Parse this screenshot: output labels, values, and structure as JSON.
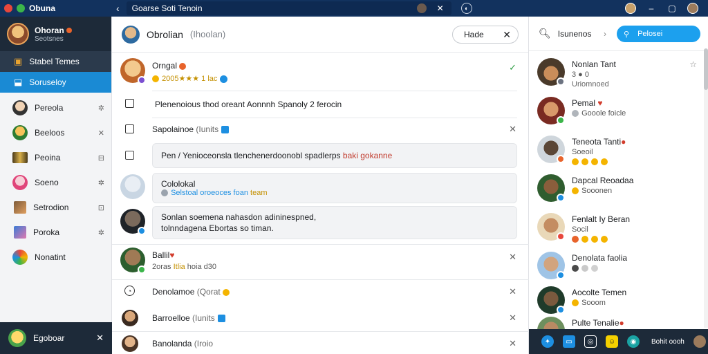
{
  "titlebar": {
    "app_title": "Obuna",
    "tab_title": "Goarse Soti Tenoin",
    "colors": {
      "bar": "#12325e",
      "red": "#e8473c",
      "green": "#3bb54a"
    }
  },
  "sidebar": {
    "profile": {
      "name": "Ohoran",
      "status": "Seotsnes"
    },
    "nav": [
      {
        "label": "Stabel Temes",
        "icon": "store-icon"
      },
      {
        "label": "Soruseloy",
        "icon": "inbox-icon"
      }
    ],
    "items": [
      {
        "label": "Pereola",
        "action": "✲"
      },
      {
        "label": "Beeloos",
        "action": "✕"
      },
      {
        "label": "Peoina",
        "action": "⊟"
      },
      {
        "label": "Soeno",
        "action": "✲"
      },
      {
        "label": "Setrodion",
        "action": "⊡"
      },
      {
        "label": "Poroka",
        "action": "✲"
      },
      {
        "label": "Nonatint",
        "action": ""
      }
    ],
    "footer": {
      "label": "Egoboar"
    }
  },
  "middle": {
    "header": {
      "name": "Obrolian",
      "sub": "(Ihoolan)",
      "button": "Hade"
    },
    "rows": [
      {
        "name": "Orngal",
        "sub": "2005★★★ 1 lac"
      },
      {
        "bubble": "Plenenoious thod oreant Aonnnh Spanoly 2 ferocin"
      },
      {
        "name": "Sapolainoe",
        "sub": "(Iunits"
      },
      {
        "bubble_main": "Pen / Yenioceonsla tlenchenerdoonobl spadlerps",
        "bubble_accent": "baki gokanne"
      },
      {
        "name": "Cololokal",
        "sub": "Selstoal oroeoces foan",
        "sub_accent": "team"
      },
      {
        "bubble_line1": "Sonlan soemena nahasdon adininespned,",
        "bubble_line2": "tolnndagena Ebortas so timan."
      },
      {
        "name": "Ballil",
        "sub_pre": "2oras",
        "sub_accent": "Itlia",
        "sub_post": "hoia d30"
      },
      {
        "name": "Denolamoe",
        "sub": "(Qorat"
      },
      {
        "name": "Barroelloe",
        "sub": "(Iunits"
      },
      {
        "name": "Banolanda",
        "sub": "(Iroio"
      }
    ],
    "colors": {
      "accent_text": "#c0392b",
      "blue": "#1d8fe1"
    }
  },
  "right": {
    "header": {
      "search_label": "Isunenos",
      "pill_label": "Pelosei"
    },
    "contacts": [
      {
        "name": "Nonlan Tant",
        "sub": "3 ● 0",
        "sub2": "Uriomnoed"
      },
      {
        "name": "Pemal",
        "sub": "Gooole foicle"
      },
      {
        "name": "Teneota Tanti",
        "sub": "Soeoil"
      },
      {
        "name": "Dapcal Reoadaa",
        "sub": "Sooonen"
      },
      {
        "name": "Fenlalt Iy Beran",
        "sub": "Socil"
      },
      {
        "name": "Denolata faolia",
        "sub": ""
      },
      {
        "name": "Aocolte Temen",
        "sub": "Sooom"
      },
      {
        "name": "Pulte Tenalie",
        "sub": ""
      }
    ],
    "footer_label": "Bohit oooh"
  }
}
